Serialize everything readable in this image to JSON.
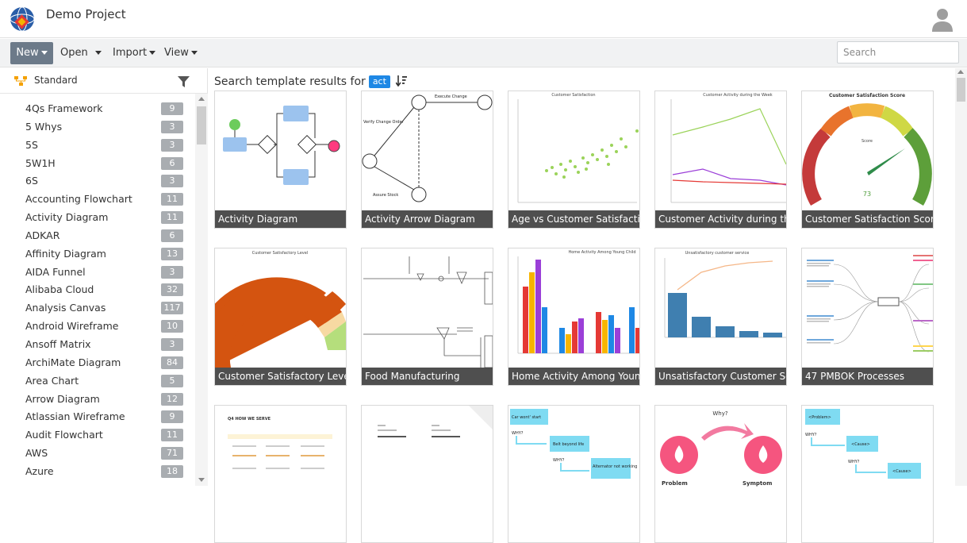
{
  "app": {
    "title": "Demo Project"
  },
  "toolbar": {
    "new_label": "New",
    "open_label": "Open",
    "import_label": "Import",
    "view_label": "View",
    "search_placeholder": "Search"
  },
  "sidebar": {
    "group_label": "Standard",
    "categories": [
      {
        "label": "4Qs Framework",
        "count": "9"
      },
      {
        "label": "5 Whys",
        "count": "3"
      },
      {
        "label": "5S",
        "count": "3"
      },
      {
        "label": "5W1H",
        "count": "6"
      },
      {
        "label": "6S",
        "count": "3"
      },
      {
        "label": "Accounting Flowchart",
        "count": "11"
      },
      {
        "label": "Activity Diagram",
        "count": "11"
      },
      {
        "label": "ADKAR",
        "count": "6"
      },
      {
        "label": "Affinity Diagram",
        "count": "13"
      },
      {
        "label": "AIDA Funnel",
        "count": "3"
      },
      {
        "label": "Alibaba Cloud",
        "count": "32"
      },
      {
        "label": "Analysis Canvas",
        "count": "117"
      },
      {
        "label": "Android Wireframe",
        "count": "10"
      },
      {
        "label": "Ansoff Matrix",
        "count": "3"
      },
      {
        "label": "ArchiMate Diagram",
        "count": "84"
      },
      {
        "label": "Area Chart",
        "count": "5"
      },
      {
        "label": "Arrow Diagram",
        "count": "12"
      },
      {
        "label": "Atlassian Wireframe",
        "count": "9"
      },
      {
        "label": "Audit Flowchart",
        "count": "11"
      },
      {
        "label": "AWS",
        "count": "71"
      },
      {
        "label": "Azure",
        "count": "18"
      }
    ]
  },
  "results": {
    "prefix": "Search template results for",
    "query": "act",
    "templates": [
      {
        "caption": "Activity Diagram"
      },
      {
        "caption": "Activity Arrow Diagram"
      },
      {
        "caption": "Age vs Customer Satisfaction"
      },
      {
        "caption": "Customer Activity during the ..."
      },
      {
        "caption": "Customer Satisfaction Score"
      },
      {
        "caption": "Customer Satisfactory Level"
      },
      {
        "caption": "Food Manufacturing"
      },
      {
        "caption": "Home Activity Among Young ..."
      },
      {
        "caption": "Unsatisfactory Customer Service"
      },
      {
        "caption": "47 PMBOK Processes"
      }
    ],
    "thumb_text": {
      "arrow_execute": "Execute Change",
      "arrow_verify": "Verify Change Order",
      "arrow_assure": "Assure Stock",
      "age_title": "Customer Satisfaction",
      "activity_title": "Customer Activity during the Week",
      "score_title": "Customer Satisfaction Score",
      "score_center": "Score",
      "score_value": "73",
      "level_title": "Customer Satisfactory Level",
      "home_title": "Home Activity Among Young Child",
      "unsat_title": "Unsatisfactory customer service",
      "serve_title": "Q4 HOW WE SERVE",
      "why_title": "Why?",
      "why_problem": "Problem",
      "why_symptom": "Symptom",
      "car_q": "Car wont' start",
      "car_why1": "WHY?",
      "car_belt": "Belt beyond life",
      "car_why2": "WHY?",
      "car_alt": "Alternator not working",
      "cause_problem": "<Problem>",
      "cause_why1": "WHY?",
      "cause_c1": "<Cause>",
      "cause_why2": "WHY?",
      "cause_c2": "<Cause>"
    }
  },
  "colors": {
    "accent": "#1e88e5",
    "new_button": "#6c7a89",
    "badge": "#a9adb1",
    "caption_bg": "#3c3c3c"
  },
  "icons": {
    "logo": "globe-diamond-logo",
    "avatar": "user-avatar-icon",
    "group": "org-chart-icon",
    "filter": "filter-icon",
    "sort": "sort-icon"
  }
}
